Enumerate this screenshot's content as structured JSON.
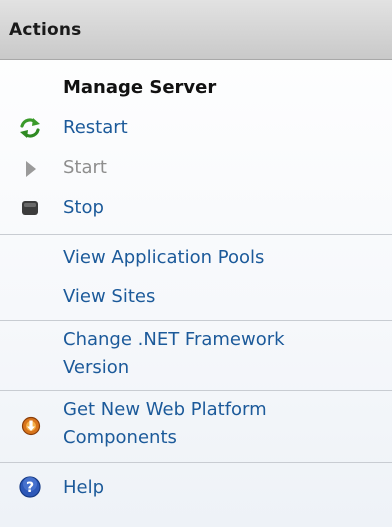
{
  "header": {
    "title": "Actions"
  },
  "section": {
    "title": "Manage Server"
  },
  "items": {
    "restart": "Restart",
    "start": "Start",
    "stop": "Stop",
    "app_pools": "View Application Pools",
    "sites": "View Sites",
    "net_line1": "Change .NET Framework",
    "net_line2": "Version",
    "wpi_line1": "Get New Web Platform",
    "wpi_line2": "Components",
    "help": "Help"
  },
  "icons": {
    "restart": "refresh-arrows-icon",
    "start": "play-triangle-icon",
    "stop": "stop-square-icon",
    "wpi": "web-platform-installer-icon",
    "help": "question-mark-icon"
  },
  "colors": {
    "link": "#1c5a9a",
    "disabled": "#8e8e8e",
    "header_bg": "#d0d0d0",
    "restart_green": "#3a9a2a",
    "wpi_orange": "#d8741c",
    "help_blue": "#2d58b8"
  }
}
